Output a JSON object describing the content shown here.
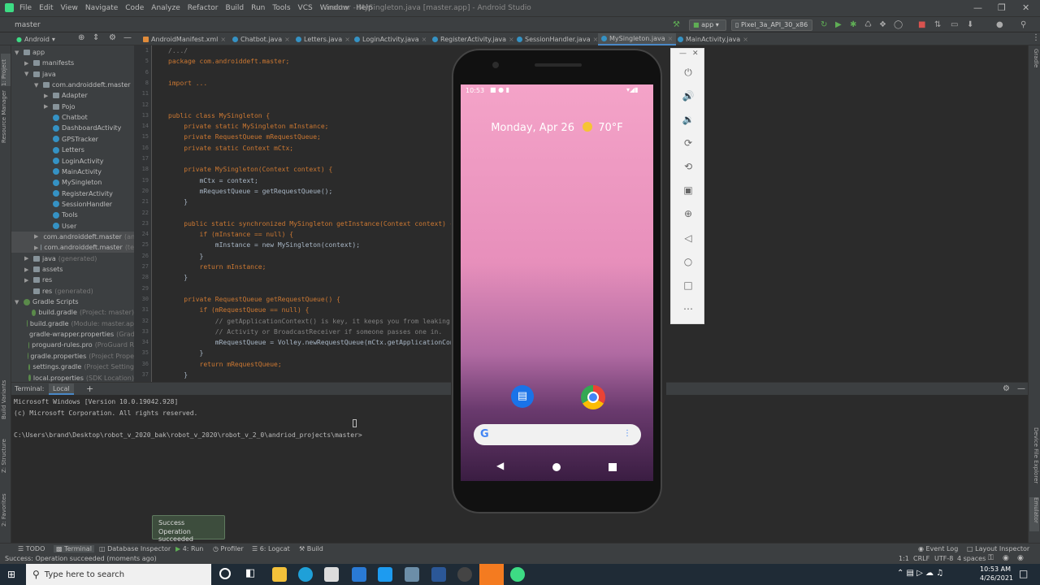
{
  "window": {
    "title": "master - MySingleton.java [master.app] - Android Studio",
    "menu": [
      "File",
      "Edit",
      "View",
      "Navigate",
      "Code",
      "Analyze",
      "Refactor",
      "Build",
      "Run",
      "Tools",
      "VCS",
      "Window",
      "Help"
    ]
  },
  "navbar": {
    "breadcrumb": "master",
    "config": "app",
    "device": "Pixel_3a_API_30_x86"
  },
  "tabs": [
    "AndroidManifest.xml",
    "Chatbot.java",
    "Letters.java",
    "LoginActivity.java",
    "RegisterActivity.java",
    "SessionHandler.java",
    "MySingleton.java",
    "MainActivity.java"
  ],
  "active_tab": "MySingleton.java",
  "left_tool_labels": [
    "1: Project",
    "Resource Manager",
    "Build Variants",
    "Z: Structure",
    "2: Favorites"
  ],
  "right_tool_labels": [
    "Gradle",
    "Device File Explorer",
    "Emulator"
  ],
  "project": {
    "view": "Android",
    "tree": [
      {
        "label": "app",
        "sub": ""
      },
      {
        "label": "manifests",
        "sub": ""
      },
      {
        "label": "java",
        "sub": ""
      },
      {
        "label": "com.androiddeft.master",
        "sub": ""
      },
      {
        "label": "Adapter",
        "sub": ""
      },
      {
        "label": "Pojo",
        "sub": ""
      },
      {
        "label": "Chatbot",
        "sub": ""
      },
      {
        "label": "DashboardActivity",
        "sub": ""
      },
      {
        "label": "GPSTracker",
        "sub": ""
      },
      {
        "label": "Letters",
        "sub": ""
      },
      {
        "label": "LoginActivity",
        "sub": ""
      },
      {
        "label": "MainActivity",
        "sub": ""
      },
      {
        "label": "MySingleton",
        "sub": ""
      },
      {
        "label": "RegisterActivity",
        "sub": ""
      },
      {
        "label": "SessionHandler",
        "sub": ""
      },
      {
        "label": "Tools",
        "sub": ""
      },
      {
        "label": "User",
        "sub": ""
      },
      {
        "label": "com.androiddeft.master",
        "sub": "(an"
      },
      {
        "label": "com.androiddeft.master",
        "sub": "(te"
      },
      {
        "label": "java",
        "sub": "(generated)"
      },
      {
        "label": "assets",
        "sub": ""
      },
      {
        "label": "res",
        "sub": ""
      },
      {
        "label": "res",
        "sub": "(generated)"
      },
      {
        "label": "Gradle Scripts",
        "sub": ""
      },
      {
        "label": "build.gradle",
        "sub": "(Project: master)"
      },
      {
        "label": "build.gradle",
        "sub": "(Module: master.ap"
      },
      {
        "label": "gradle-wrapper.properties",
        "sub": "(Grad"
      },
      {
        "label": "proguard-rules.pro",
        "sub": "(ProGuard R"
      },
      {
        "label": "gradle.properties",
        "sub": "(Project Prope"
      },
      {
        "label": "settings.gradle",
        "sub": "(Project Setting"
      },
      {
        "label": "local.properties",
        "sub": "(SDK Location)"
      }
    ]
  },
  "code": [
    {
      "n": "1",
      "t": "/.../"
    },
    {
      "n": "5",
      "t": "package com.androiddeft.master;"
    },
    {
      "n": "6",
      "t": ""
    },
    {
      "n": "8",
      "t": "import ..."
    },
    {
      "n": "11",
      "t": ""
    },
    {
      "n": "12",
      "t": ""
    },
    {
      "n": "13",
      "t": "public class MySingleton {"
    },
    {
      "n": "14",
      "t": "    private static MySingleton mInstance;"
    },
    {
      "n": "15",
      "t": "    private RequestQueue mRequestQueue;"
    },
    {
      "n": "16",
      "t": "    private static Context mCtx;"
    },
    {
      "n": "17",
      "t": ""
    },
    {
      "n": "18",
      "t": "    private MySingleton(Context context) {"
    },
    {
      "n": "19",
      "t": "        mCtx = context;"
    },
    {
      "n": "20",
      "t": "        mRequestQueue = getRequestQueue();"
    },
    {
      "n": "21",
      "t": "    }"
    },
    {
      "n": "22",
      "t": ""
    },
    {
      "n": "23",
      "t": "    public static synchronized MySingleton getInstance(Context context) {"
    },
    {
      "n": "24",
      "t": "        if (mInstance == null) {"
    },
    {
      "n": "25",
      "t": "            mInstance = new MySingleton(context);"
    },
    {
      "n": "26",
      "t": "        }"
    },
    {
      "n": "27",
      "t": "        return mInstance;"
    },
    {
      "n": "28",
      "t": "    }"
    },
    {
      "n": "29",
      "t": ""
    },
    {
      "n": "30",
      "t": "    private RequestQueue getRequestQueue() {"
    },
    {
      "n": "31",
      "t": "        if (mRequestQueue == null) {"
    },
    {
      "n": "32",
      "t": "            // getApplicationContext() is key, it keeps you from leaking t"
    },
    {
      "n": "33",
      "t": "            // Activity or BroadcastReceiver if someone passes one in."
    },
    {
      "n": "34",
      "t": "            mRequestQueue = Volley.newRequestQueue(mCtx.getApplicationCont"
    },
    {
      "n": "35",
      "t": "        }"
    },
    {
      "n": "36",
      "t": "        return mRequestQueue;"
    },
    {
      "n": "37",
      "t": "    }"
    }
  ],
  "terminal": {
    "title": "Terminal:",
    "tab": "Local",
    "add": "+",
    "lines": [
      "Microsoft Windows [Version 10.0.19042.928]",
      "(c) Microsoft Corporation. All rights reserved.",
      "",
      "C:\\Users\\brand\\Desktop\\robot_v_2020_bak\\robot_v_2020\\robot_v_2_0\\andriod_projects\\master>"
    ]
  },
  "phone": {
    "time": "10:53",
    "date": "Monday, Apr 26",
    "temp": "70°F"
  },
  "toast": {
    "title": "Success",
    "message": "Operation succeeded"
  },
  "bottom_tools": [
    "TODO",
    "Terminal",
    "Database Inspector",
    "4: Run",
    "Profiler",
    "6: Logcat",
    "Build",
    "Event Log",
    "Layout Inspector"
  ],
  "status": {
    "message": "Success: Operation succeeded (moments ago)",
    "pos": "1:1",
    "crlf": "CRLF",
    "enc": "UTF-8",
    "indent": "4 spaces"
  },
  "taskbar": {
    "search": "Type here to search",
    "time": "10:53 AM",
    "date": "4/26/2021"
  }
}
